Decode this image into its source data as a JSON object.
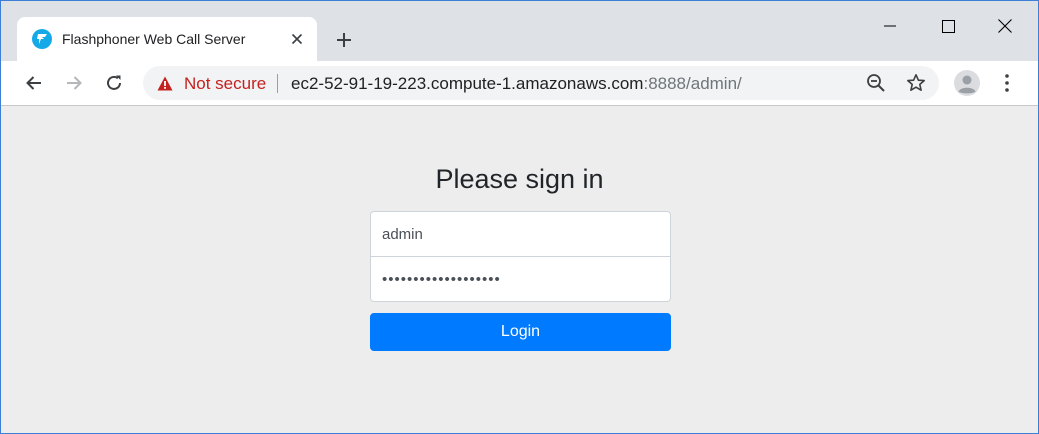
{
  "colors": {
    "accent": "#007bff",
    "not_secure": "#c5221f",
    "favicon": "#16a9e8",
    "page_bg": "#ededed"
  },
  "browser": {
    "tab": {
      "title": "Flashphoner Web Call Server",
      "favicon": "flashphoner-logo-icon",
      "close_icon": "close-icon"
    },
    "new_tab_icon": "plus-icon",
    "window_controls": [
      "minimize-icon",
      "maximize-icon",
      "close-icon"
    ],
    "nav": {
      "back_icon": "arrow-left-icon",
      "forward_icon": "arrow-right-icon",
      "reload_icon": "reload-icon"
    },
    "omnibox": {
      "security_icon": "warning-triangle-icon",
      "security_label": "Not secure",
      "url_host": "ec2-52-91-19-223.compute-1.amazonaws.com",
      "url_rest": ":8888/admin/",
      "zoom_icon": "zoom-out-icon",
      "bookmark_icon": "star-icon"
    },
    "profile_icon": "avatar-icon",
    "menu_icon": "kebab-menu-icon"
  },
  "page": {
    "heading": "Please sign in",
    "username_value": "admin",
    "password_value": "•••••••••••••••••••",
    "login_label": "Login"
  }
}
